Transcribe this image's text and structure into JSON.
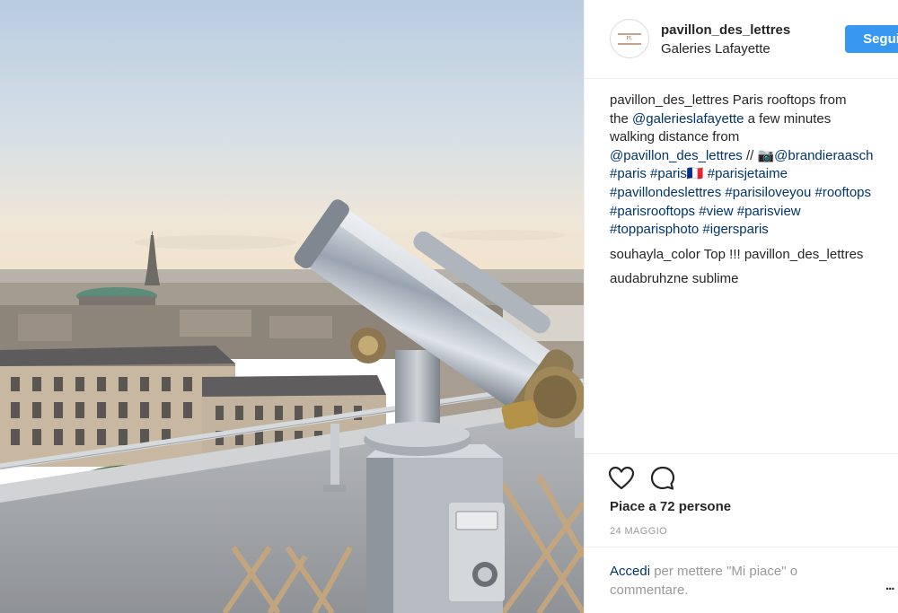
{
  "header": {
    "username": "pavillon_des_lettres",
    "location": "Galeries Lafayette",
    "follow_label": "Segui"
  },
  "caption": {
    "user": "pavillon_des_lettres",
    "text1": " Paris rooftops from",
    "line2_prefix": "the ",
    "mention1": "@galerieslafayette",
    "line2_suffix": " a few minutes",
    "line3": "walking distance from",
    "mention2": "@pavillon_des_lettres",
    "line4_mid": " // 📷",
    "mention3": "@brandieraasch",
    "hashtags_line5": [
      "#paris",
      "#paris🇫🇷",
      "#parisjetaime"
    ],
    "hashtags_line6": [
      "#pavillondeslettres",
      "#parisiloveyou",
      "#rooftops"
    ],
    "hashtags_line7": [
      "#parisrooftops",
      "#view",
      "#parisview"
    ],
    "hashtags_line8": [
      "#topparisphoto",
      "#igersparis"
    ]
  },
  "comments": [
    {
      "user": "souhayla_color",
      "text": " Top !!! pavillon_des_lettres"
    },
    {
      "user": "audabruhzne",
      "text": " sublime"
    }
  ],
  "likes_text": "Piace a 72 persone",
  "date": "24 MAGGIO",
  "login": {
    "link": "Accedi",
    "text": " per mettere \"Mi piace\" o commentare."
  },
  "more_label": "...",
  "icons": [
    "heart-icon",
    "comment-icon"
  ],
  "colors": {
    "follow_button": "#3897f0",
    "link": "#003569",
    "muted": "#999999"
  }
}
